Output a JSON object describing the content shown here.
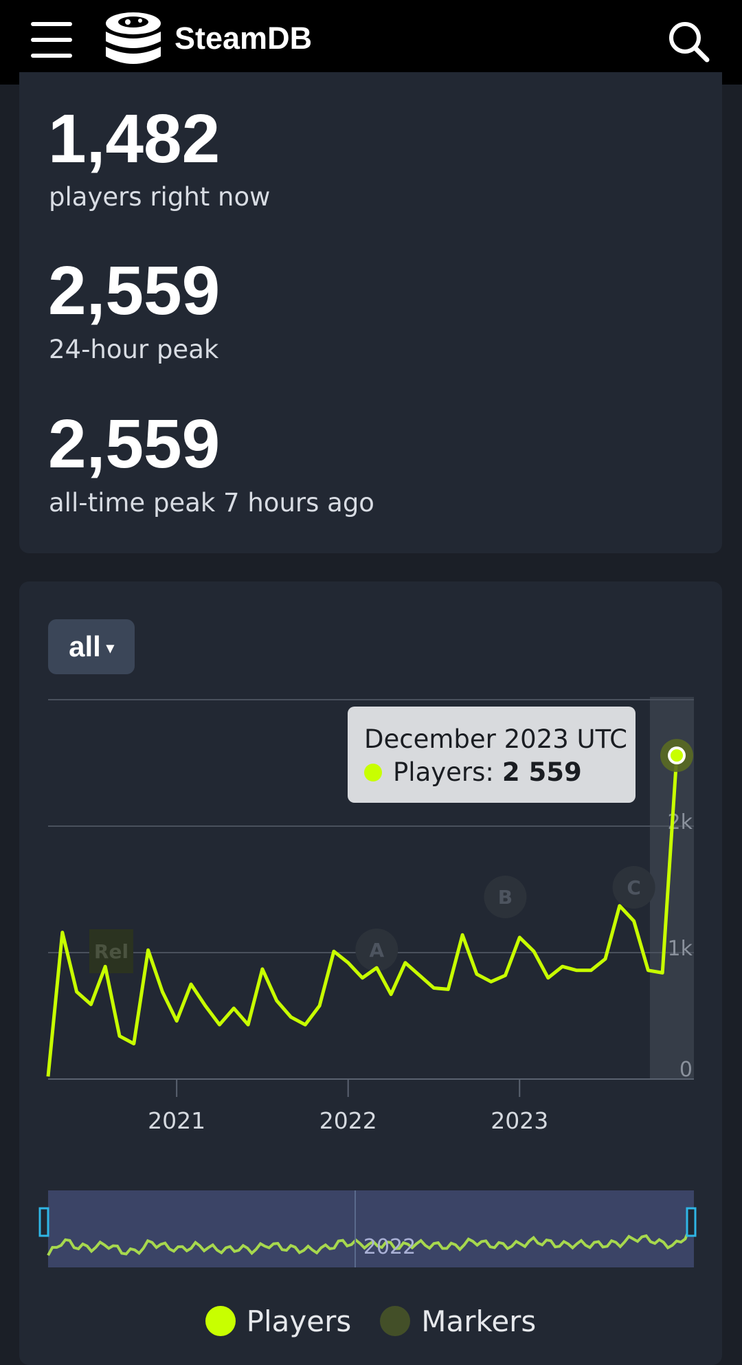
{
  "header": {
    "brand": "SteamDB",
    "menu_icon": "hamburger-menu-icon",
    "logo_icon": "steamdb-logo-icon",
    "search_icon": "search-icon"
  },
  "stats": [
    {
      "value": "1,482",
      "label": "players right now"
    },
    {
      "value": "2,559",
      "label": "24-hour peak"
    },
    {
      "value": "2,559",
      "label": "all-time peak 7 hours ago"
    }
  ],
  "range_selector": {
    "label": "all",
    "caret": "▾"
  },
  "tooltip": {
    "title": "December 2023 UTC",
    "series": "Players:",
    "value": "2 559"
  },
  "navigator": {
    "label": "2022"
  },
  "legend": [
    {
      "label": "Players",
      "color": "#c8ff00"
    },
    {
      "label": "Markers",
      "color": "#434f28"
    }
  ],
  "chart_data": {
    "type": "line",
    "series": [
      {
        "name": "Players",
        "color": "#c8ff00",
        "x": [
          "2020-04",
          "2020-05",
          "2020-06",
          "2020-07",
          "2020-08",
          "2020-09",
          "2020-10",
          "2020-11",
          "2020-12",
          "2021-01",
          "2021-02",
          "2021-03",
          "2021-04",
          "2021-05",
          "2021-06",
          "2021-07",
          "2021-08",
          "2021-09",
          "2021-10",
          "2021-11",
          "2021-12",
          "2022-01",
          "2022-02",
          "2022-03",
          "2022-04",
          "2022-05",
          "2022-06",
          "2022-07",
          "2022-08",
          "2022-09",
          "2022-10",
          "2022-11",
          "2022-12",
          "2023-01",
          "2023-02",
          "2023-03",
          "2023-04",
          "2023-05",
          "2023-06",
          "2023-07",
          "2023-08",
          "2023-09",
          "2023-10",
          "2023-11",
          "2023-12"
        ],
        "y": [
          20,
          1160,
          690,
          590,
          890,
          340,
          280,
          1020,
          690,
          460,
          750,
          580,
          430,
          560,
          430,
          870,
          620,
          490,
          430,
          580,
          1010,
          920,
          800,
          880,
          670,
          920,
          820,
          720,
          710,
          1140,
          830,
          770,
          820,
          1120,
          1010,
          800,
          890,
          860,
          860,
          950,
          1370,
          1250,
          860,
          840,
          2559
        ]
      }
    ],
    "markers": [
      {
        "label": "Rel",
        "x": "2020-09"
      },
      {
        "label": "A",
        "x": "2022-03"
      },
      {
        "label": "B",
        "x": "2022-12"
      },
      {
        "label": "C",
        "x": "2023-09"
      }
    ],
    "yticks": [
      "0",
      "1k",
      "2k"
    ],
    "xticks": [
      "2021",
      "2022",
      "2023"
    ],
    "ylim": [
      0,
      3000
    ],
    "grid": true,
    "highlighted_point": {
      "x": "2023-12",
      "y": 2559
    }
  }
}
